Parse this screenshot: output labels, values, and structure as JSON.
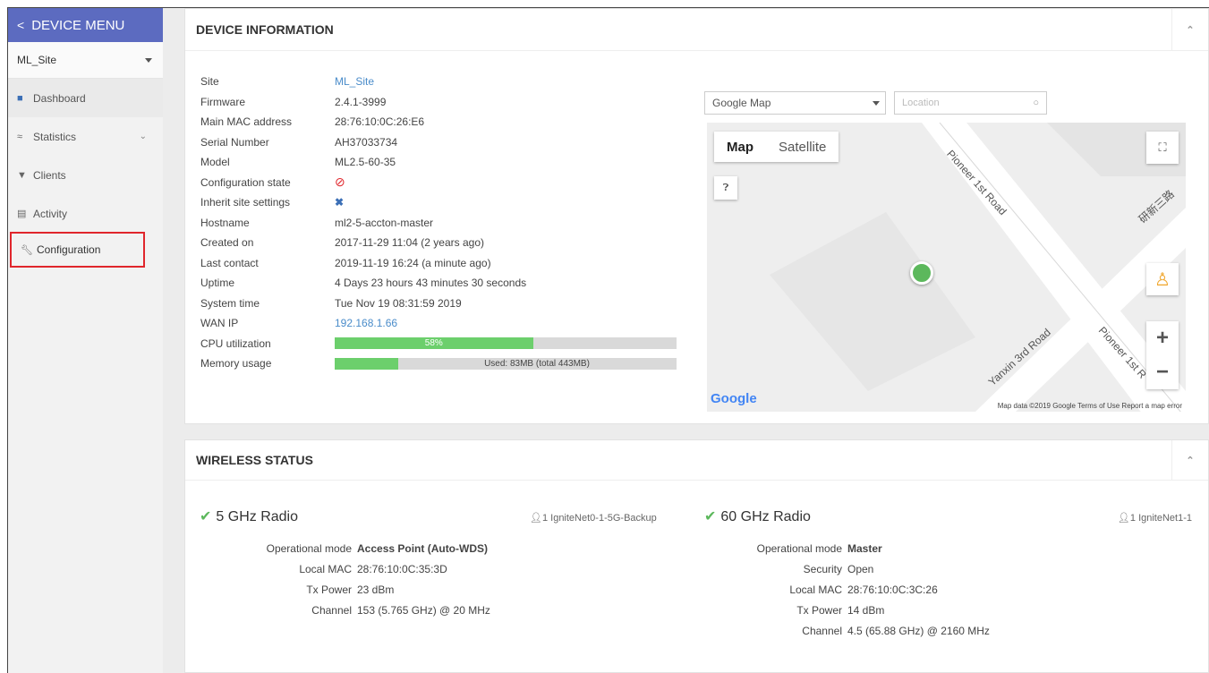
{
  "sidebar": {
    "header": "DEVICE MENU",
    "site": "ML_Site",
    "items": [
      {
        "label": "Dashboard"
      },
      {
        "label": "Statistics"
      },
      {
        "label": "Clients"
      },
      {
        "label": "Activity"
      },
      {
        "label": "Configuration"
      }
    ]
  },
  "device_info": {
    "title": "DEVICE INFORMATION",
    "rows": [
      {
        "label": "Site",
        "value": "ML_Site"
      },
      {
        "label": "Firmware",
        "value": "2.4.1-3999"
      },
      {
        "label": "Main MAC address",
        "value": "28:76:10:0C:26:E6"
      },
      {
        "label": "Serial Number",
        "value": "AH37033734"
      },
      {
        "label": "Model",
        "value": "ML2.5-60-35"
      },
      {
        "label": "Configuration state",
        "value": ""
      },
      {
        "label": "Inherit site settings",
        "value": ""
      },
      {
        "label": "Hostname",
        "value": "ml2-5-accton-master"
      },
      {
        "label": "Created on",
        "value": "2017-11-29 11:04 (2 years ago)"
      },
      {
        "label": "Last contact",
        "value": "2019-11-19 16:24 (a minute ago)"
      },
      {
        "label": "Uptime",
        "value": "4 Days 23 hours 43 minutes 30 seconds"
      },
      {
        "label": "System time",
        "value": "Tue Nov 19 08:31:59 2019"
      },
      {
        "label": "WAN IP",
        "value": "192.168.1.66"
      },
      {
        "label": "CPU utilization",
        "value": "58%"
      },
      {
        "label": "Memory usage",
        "value": "Used: 83MB (total 443MB)"
      }
    ],
    "cpu_fraction": 0.58,
    "mem_fraction": 0.187
  },
  "map": {
    "provider": "Google Map",
    "location_placeholder": "Location",
    "tab_map": "Map",
    "tab_satellite": "Satellite",
    "road1": "Pioneer 1st Road",
    "road2": "Yanxin 3rd Road",
    "road3": "Pioneer 1st R",
    "road4": "研新三路",
    "brand": "Google",
    "attribution": "Map data ©2019 Google   Terms of Use   Report a map error"
  },
  "wireless": {
    "title": "WIRELESS STATUS",
    "radio5": {
      "title": "5 GHz Radio",
      "ssid": "1  IgniteNet0-1-5G-Backup",
      "rows": [
        {
          "k": "Operational mode",
          "v": "Access Point (Auto-WDS)"
        },
        {
          "k": "Local MAC",
          "v": "28:76:10:0C:35:3D"
        },
        {
          "k": "Tx Power",
          "v": "23 dBm"
        },
        {
          "k": "Channel",
          "v": "153 (5.765 GHz) @ 20 MHz"
        }
      ]
    },
    "radio60": {
      "title": "60 GHz Radio",
      "ssid": "1  IgniteNet1-1",
      "rows": [
        {
          "k": "Operational mode",
          "v": "Master"
        },
        {
          "k": "Security",
          "v": "Open"
        },
        {
          "k": "Local MAC",
          "v": "28:76:10:0C:3C:26"
        },
        {
          "k": "Tx Power",
          "v": "14 dBm"
        },
        {
          "k": "Channel",
          "v": "4.5 (65.88 GHz) @ 2160 MHz"
        }
      ]
    }
  },
  "colors": {
    "accent": "#5c6bc0",
    "highlight": "#e0262c",
    "bar": "#6ccf6c",
    "link": "#4a8cca"
  }
}
